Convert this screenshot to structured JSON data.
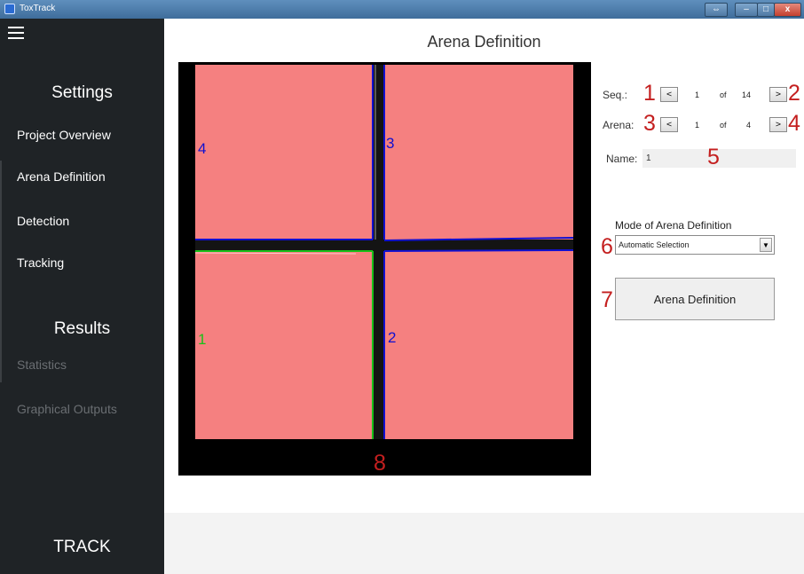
{
  "window": {
    "title": "ToxTrack"
  },
  "sidebar": {
    "settings_heading": "Settings",
    "settings_items": [
      "Project Overview",
      "Arena Definition",
      "Detection",
      "Tracking"
    ],
    "results_heading": "Results",
    "results_items": [
      "Statistics",
      "Graphical Outputs"
    ],
    "track_label": "TRACK"
  },
  "main": {
    "title": "Arena Definition",
    "seq": {
      "label": "Seq.:",
      "current": "1",
      "of": "of",
      "total": "14",
      "prev": "<",
      "next": ">"
    },
    "arena": {
      "label": "Arena:",
      "current": "1",
      "of": "of",
      "total": "4",
      "prev": "<",
      "next": ">"
    },
    "name": {
      "label": "Name:",
      "value": "1"
    },
    "mode": {
      "label": "Mode of Arena Definition",
      "selected": "Automatic Selection"
    },
    "arena_button": "Arena Definition",
    "arena_labels": [
      "4",
      "3",
      "1",
      "2"
    ]
  },
  "callouts": [
    "1",
    "2",
    "3",
    "4",
    "5",
    "6",
    "7",
    "8"
  ],
  "colors": {
    "arena_fill": "#f58080",
    "accent_red": "#c41f1f",
    "arena_blue": "#1010d0",
    "arena_green": "#18c018",
    "sidebar_bg": "#1f2326"
  }
}
